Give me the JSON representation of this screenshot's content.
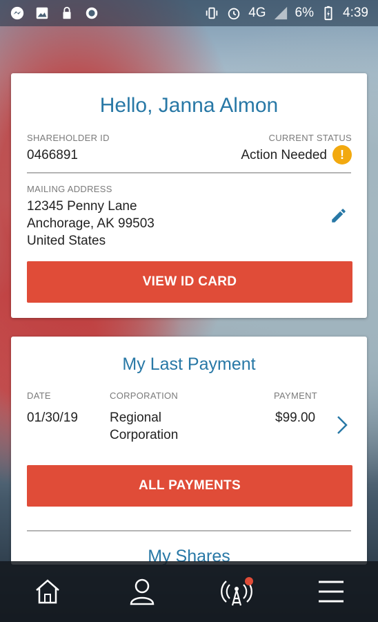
{
  "statusbar": {
    "network": "4G",
    "battery": "6%",
    "time": "4:39"
  },
  "profile": {
    "greeting": "Hello, Janna Almon",
    "shareholder_id_label": "SHAREHOLDER ID",
    "shareholder_id": "0466891",
    "status_label": "CURRENT STATUS",
    "status": "Action Needed",
    "status_icon": "!",
    "address_label": "MAILING ADDRESS",
    "address_line1": "12345 Penny Lane",
    "address_line2": "Anchorage, AK 99503",
    "address_line3": "United States",
    "view_id_button": "VIEW ID CARD"
  },
  "payment": {
    "title": "My Last Payment",
    "date_label": "DATE",
    "corporation_label": "CORPORATION",
    "payment_label": "PAYMENT",
    "date": "01/30/19",
    "corporation_line1": "Regional",
    "corporation_line2": "Corporation",
    "amount": "$99.00",
    "all_payments_button": "ALL PAYMENTS"
  },
  "shares": {
    "title": "My Shares"
  },
  "nav": {
    "items": [
      "home-icon",
      "profile-icon",
      "broadcast-icon",
      "menu-icon"
    ]
  },
  "colors": {
    "accent": "#2878a6",
    "button": "#e04c38",
    "warning": "#f2a90f"
  }
}
